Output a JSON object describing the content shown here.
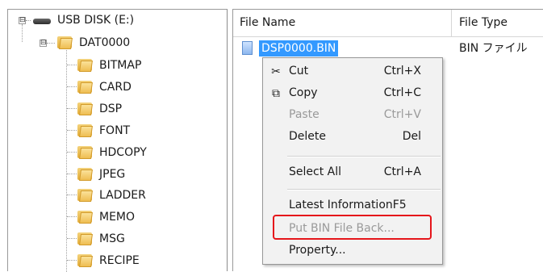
{
  "tree": {
    "root_label": "USB DISK (E:)",
    "root_expander": "⊟",
    "folder_label": "DAT0000",
    "folder_expander": "⊟",
    "children": [
      "BITMAP",
      "CARD",
      "DSP",
      "FONT",
      "HDCOPY",
      "JPEG",
      "LADDER",
      "MEMO",
      "MSG",
      "RECIPE"
    ]
  },
  "list": {
    "columns": [
      "File Name",
      "File Type"
    ],
    "rows": [
      {
        "name": "DSP0000.BIN",
        "type": "BIN ファイル"
      }
    ]
  },
  "context_menu": {
    "items": [
      {
        "label": "Cut",
        "shortcut": "Ctrl+X",
        "icon": "scissors-icon",
        "enabled": true
      },
      {
        "label": "Copy",
        "shortcut": "Ctrl+C",
        "icon": "copy-icon",
        "enabled": true
      },
      {
        "label": "Paste",
        "shortcut": "Ctrl+V",
        "icon": "",
        "enabled": false
      },
      {
        "label": "Delete",
        "shortcut": "Del",
        "icon": "",
        "enabled": true
      },
      {
        "label": "Select All",
        "shortcut": "Ctrl+A",
        "icon": "",
        "enabled": true
      },
      {
        "label": "Latest InformationF5",
        "shortcut": "",
        "icon": "",
        "enabled": true
      },
      {
        "label": "Put BIN File Back...",
        "shortcut": "",
        "icon": "",
        "enabled": false
      },
      {
        "label": "Property...",
        "shortcut": "",
        "icon": "",
        "enabled": true
      }
    ],
    "highlighted_item": "Put BIN File Back...",
    "highlight_color": "#e5161b"
  },
  "colors": {
    "selection": "#3399ff",
    "disabled_text": "#9a9a9a",
    "menu_bg": "#f2f2f2"
  }
}
